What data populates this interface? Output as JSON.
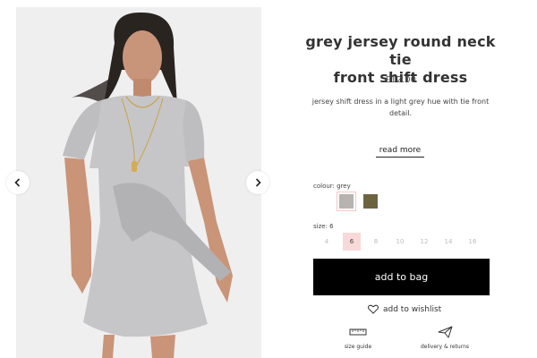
{
  "product": {
    "title_line1": "grey jersey round neck tie",
    "title_line2": "front shift dress",
    "price": "£12.00",
    "description": "jersey shift dress in a light grey hue with tie front detail.",
    "read_more_label": "read more"
  },
  "gallery": {
    "image_alt_name": "model-wearing-grey-dress",
    "prev_icon": "chevron-left-icon",
    "next_icon": "chevron-right-icon"
  },
  "colour": {
    "label": "colour: grey",
    "options": [
      {
        "name": "grey",
        "hex": "#b7b3b1",
        "selected": true
      },
      {
        "name": "olive",
        "hex": "#6c6440",
        "selected": false
      }
    ]
  },
  "size": {
    "label": "size: 6",
    "options": [
      "4",
      "6",
      "8",
      "10",
      "12",
      "14",
      "16"
    ],
    "selected": "6"
  },
  "actions": {
    "add_to_bag": "add to bag",
    "wishlist": "add to wishlist"
  },
  "utilities": {
    "size_guide": "size guide",
    "delivery_returns": "delivery & returns"
  },
  "colors": {
    "accent_selected": "#f8d9d9",
    "button_bg": "#000000",
    "button_text": "#ffffff"
  }
}
